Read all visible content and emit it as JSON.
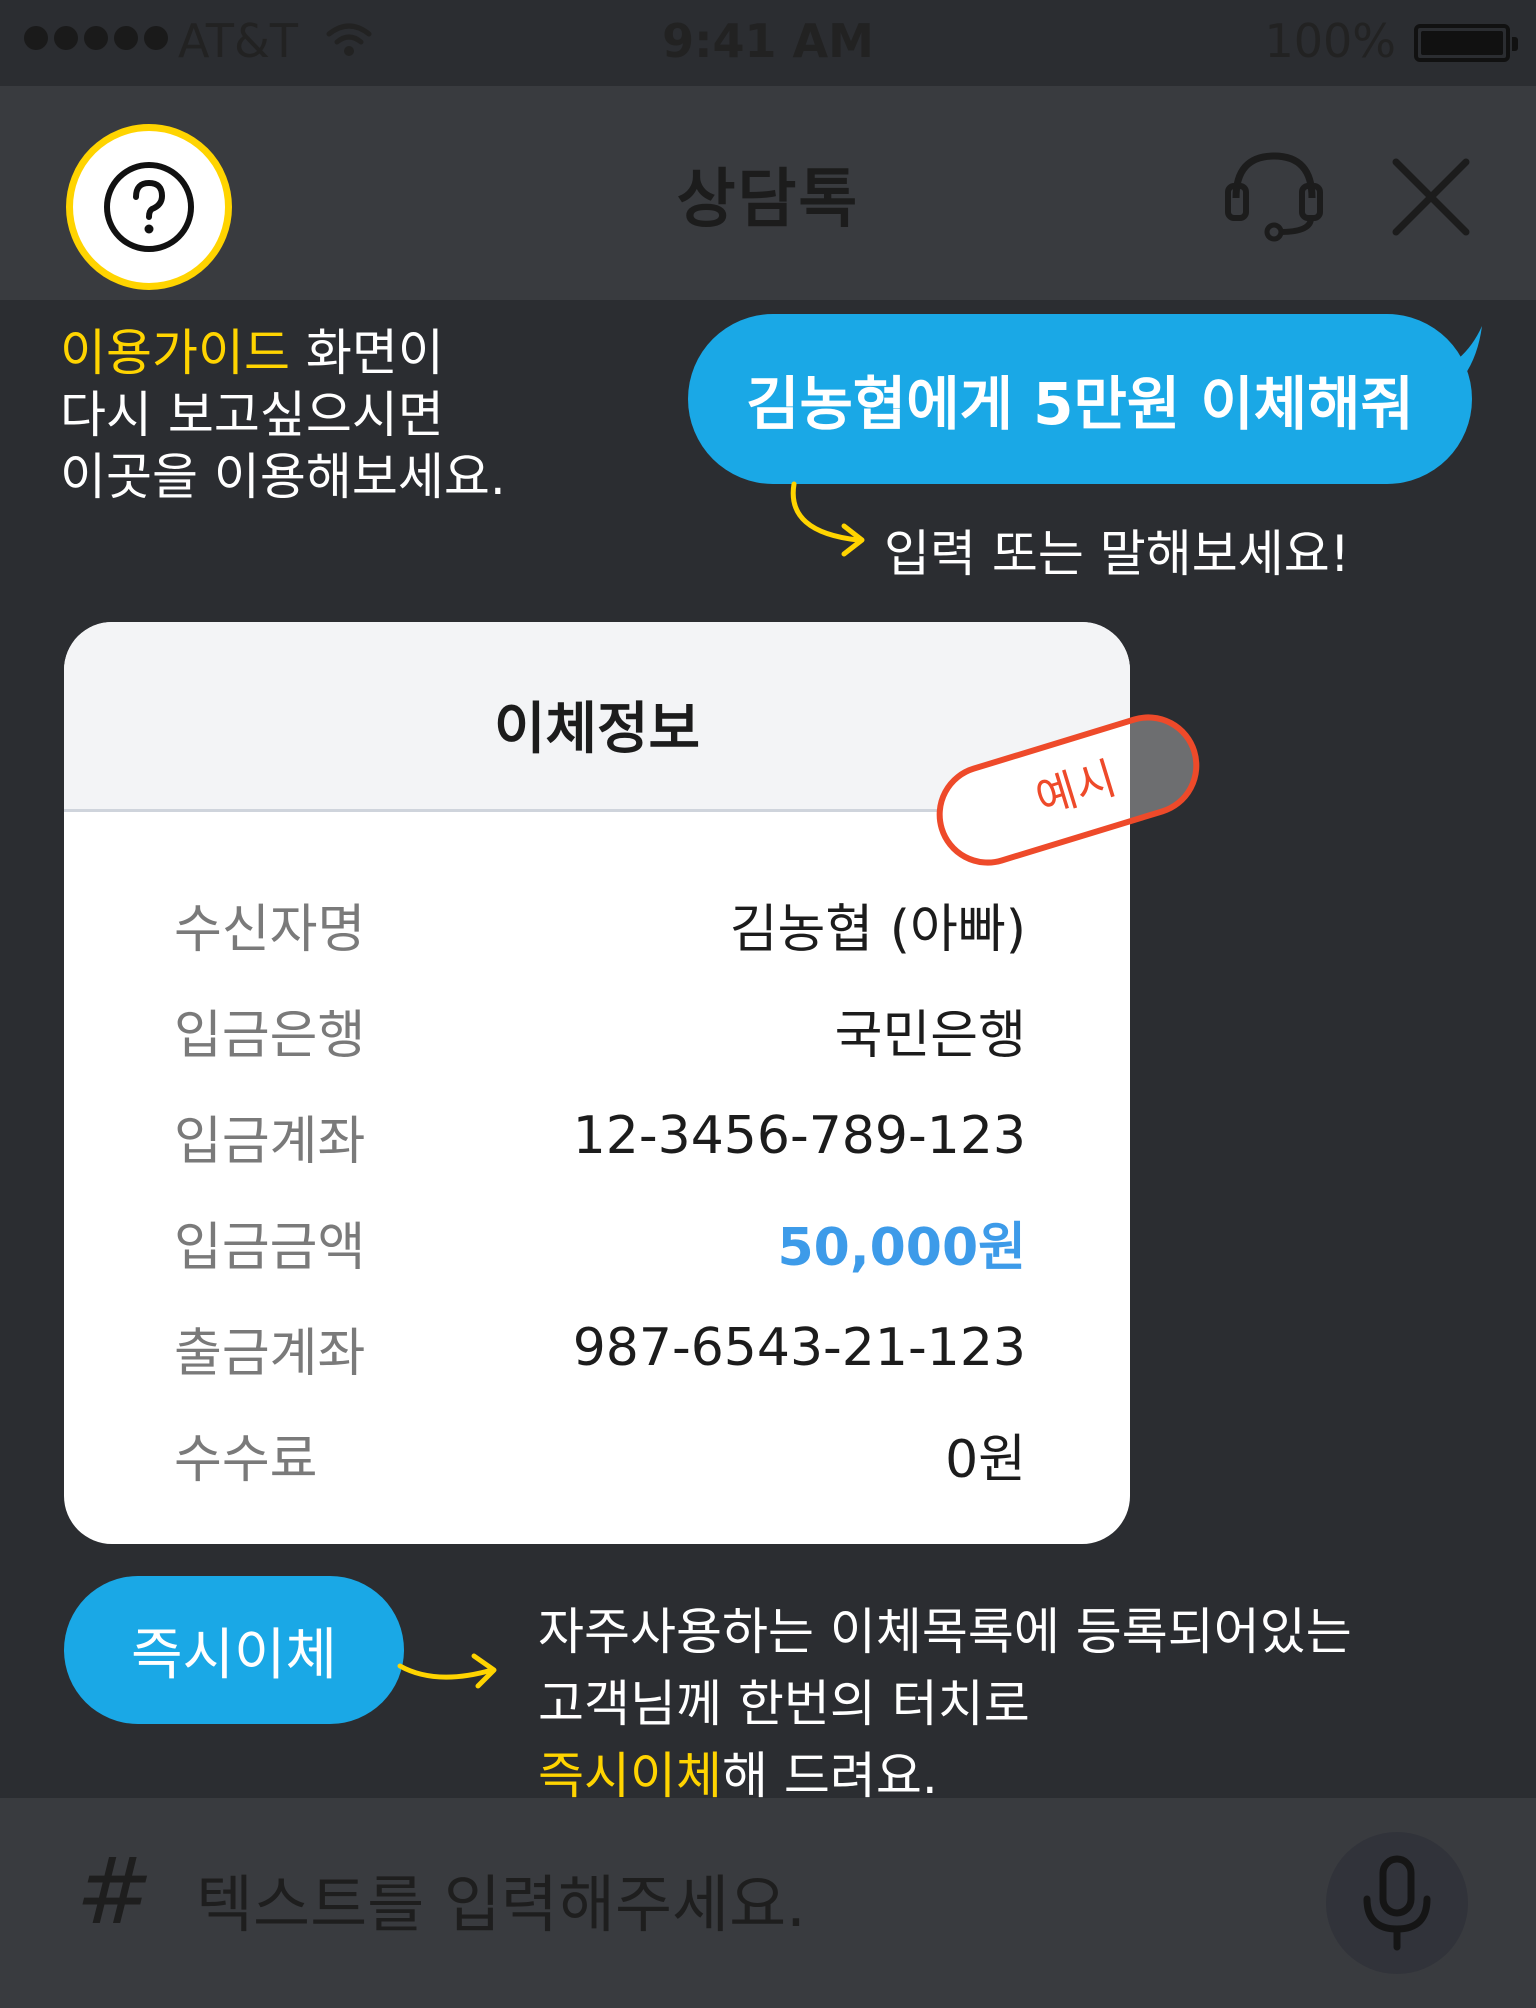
{
  "status_bar": {
    "carrier": "AT&T",
    "time": "9:41 AM",
    "battery": "100%"
  },
  "header": {
    "title": "상담톡",
    "help_icon": "question-circle-icon",
    "headset_icon": "headset-icon",
    "close_icon": "close-icon"
  },
  "guide": {
    "help_highlight": "이용가이드",
    "help_line1_rest": " 화면이",
    "help_line2": "다시 보고싶으시면",
    "help_line3": "이곳을 이용해보세요.",
    "example_utterance": "김농협에게 5만원 이체해줘",
    "input_hint": "입력 또는 말해보세요!",
    "instant_line1": "자주사용하는 이체목록에 등록되어있는",
    "instant_line2": "고객님께 한번의 터치로",
    "instant_highlight": "즉시이체",
    "instant_line3_rest": "해 드려요."
  },
  "transfer_card": {
    "title": "이체정보",
    "stamp": "예시",
    "rows": [
      {
        "label": "수신자명",
        "value": "김농협 (아빠)"
      },
      {
        "label": "입금은행",
        "value": "국민은행"
      },
      {
        "label": "입금계좌",
        "value": "12-3456-789-123"
      },
      {
        "label": "입금금액",
        "value": "50,000원"
      },
      {
        "label": "출금계좌",
        "value": "987-6543-21-123"
      },
      {
        "label": "수수료",
        "value": "0원"
      }
    ]
  },
  "instant_button": {
    "label": "즉시이체"
  },
  "input_bar": {
    "hash": "#",
    "placeholder": "텍스트를 입력해주세요.",
    "mic_icon": "microphone-icon"
  },
  "colors": {
    "accent_blue": "#1aa8e6",
    "highlight_yellow": "#ffd400",
    "amount_blue": "#3d9be9",
    "stamp_red": "#ee4a2a"
  }
}
